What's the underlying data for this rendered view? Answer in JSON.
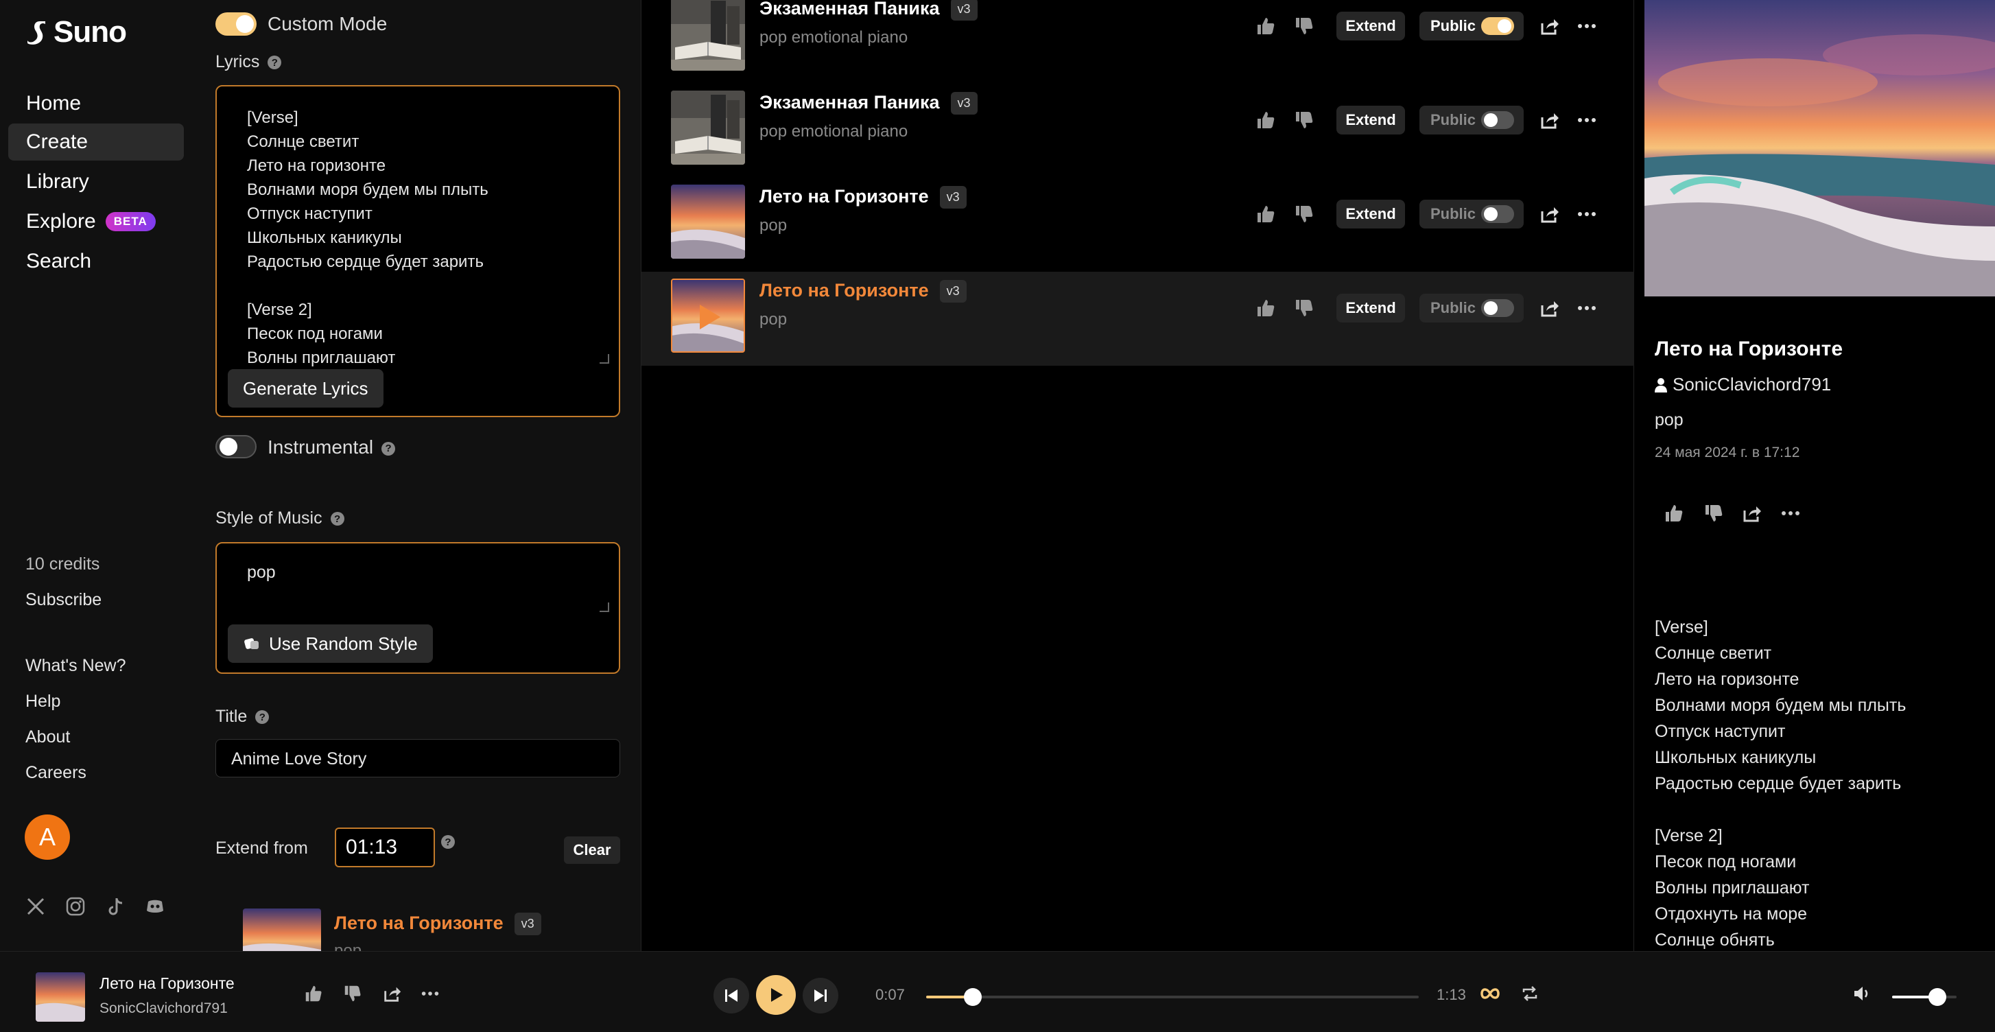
{
  "nav": {
    "brand": "Suno",
    "items": [
      {
        "label": "Home",
        "active": false
      },
      {
        "label": "Create",
        "active": true
      },
      {
        "label": "Library",
        "active": false
      },
      {
        "label": "Explore",
        "active": false,
        "badge": "BETA"
      },
      {
        "label": "Search",
        "active": false
      }
    ],
    "credits": "10 credits",
    "subscribe": "Subscribe",
    "links": [
      "What's New?",
      "Help",
      "About",
      "Careers"
    ],
    "avatar_letter": "A",
    "socials": [
      "x-icon",
      "instagram-icon",
      "tiktok-icon",
      "discord-icon"
    ]
  },
  "create": {
    "custom_mode_label": "Custom Mode",
    "custom_mode_on": true,
    "lyrics_label": "Lyrics",
    "lyrics_text": "[Verse]\nСолнце светит\nЛето на горизонте\nВолнами моря будем мы плыть\nОтпуск наступит\nШкольных каникулы\nРадостью сердце будет зарить\n\n[Verse 2]\nПесок под ногами\nВолны приглашают",
    "generate_lyrics_label": "Generate Lyrics",
    "instrumental_label": "Instrumental",
    "instrumental_on": false,
    "style_label": "Style of Music",
    "style_value": "pop",
    "random_style_label": "Use Random Style",
    "title_label": "Title",
    "title_value": "Anime Love Story",
    "extend_label": "Extend from",
    "extend_value": "01:13",
    "clear_label": "Clear",
    "extend_song": {
      "title": "Лето на Горизонте",
      "version": "v3",
      "style": "pop"
    }
  },
  "songs": [
    {
      "title": "Экзаменная Паника",
      "version": "v3",
      "style": "pop emotional piano",
      "public": true,
      "selected": false,
      "thumb": "books"
    },
    {
      "title": "Экзаменная Паника",
      "version": "v3",
      "style": "pop emotional piano",
      "public": false,
      "selected": false,
      "thumb": "books"
    },
    {
      "title": "Лето на Горизонте",
      "version": "v3",
      "style": "pop",
      "public": false,
      "selected": false,
      "thumb": "sunset"
    },
    {
      "title": "Лето на Горизонте",
      "version": "v3",
      "style": "pop",
      "public": false,
      "selected": true,
      "thumb": "sunset"
    }
  ],
  "song_actions": {
    "extend_label": "Extend",
    "public_label": "Public"
  },
  "detail": {
    "title": "Лето на Горизонте",
    "user": "SonicClavichord791",
    "style": "pop",
    "date": "24 мая 2024 г. в 17:12",
    "lyrics": "[Verse]\nСолнце светит\nЛето на горизонте\nВолнами моря будем мы плыть\nОтпуск наступит\nШкольных каникулы\nРадостью сердце будет зарить\n\n[Verse 2]\nПесок под ногами\nВолны приглашают\nОтдохнуть на море\nСолнце обнять"
  },
  "player": {
    "title": "Лето на Горизонте",
    "user": "SonicClavichord791",
    "elapsed": "0:07",
    "duration": "1:13",
    "progress": 0.095,
    "volume": 0.7
  },
  "colors": {
    "accent": "#f2883a",
    "toggle_on": "#f7c979",
    "panel": "#111111",
    "border_accent": "#c27a2a"
  }
}
